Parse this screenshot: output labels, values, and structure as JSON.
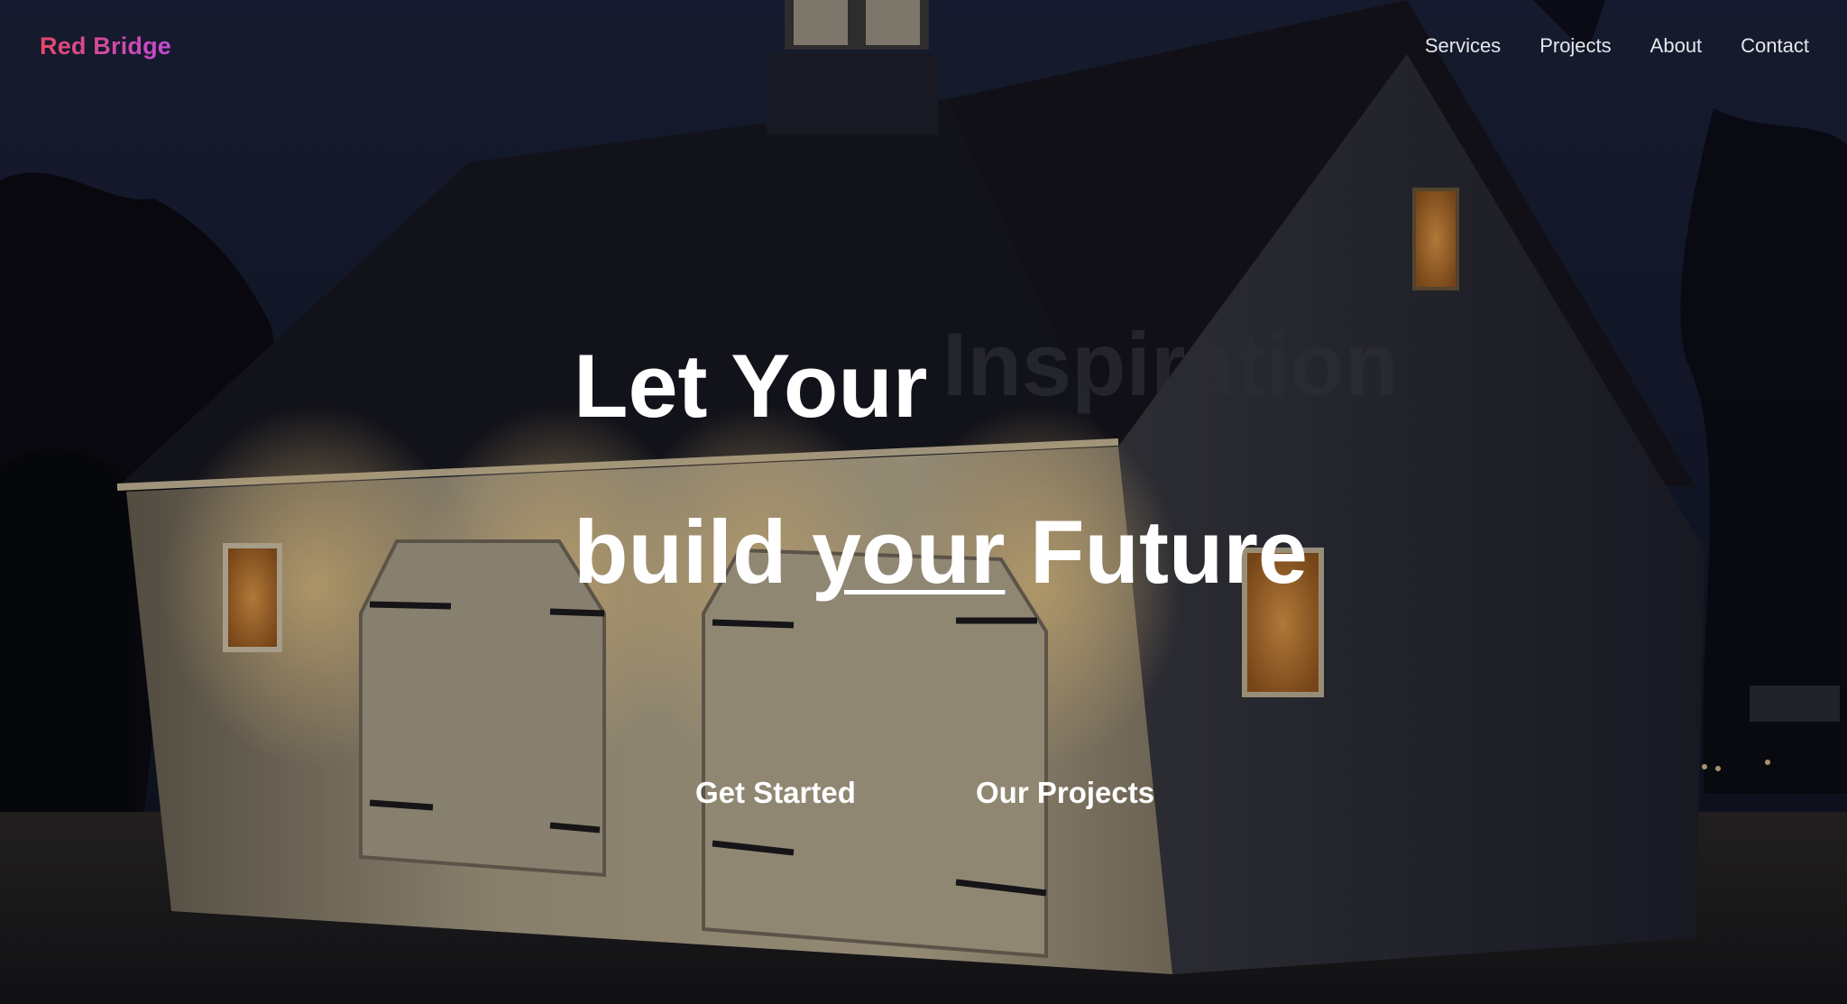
{
  "brand": {
    "name": "Red Bridge"
  },
  "nav": {
    "items": [
      {
        "label": "Services"
      },
      {
        "label": "Projects"
      },
      {
        "label": "About"
      },
      {
        "label": "Contact"
      }
    ]
  },
  "hero": {
    "line1": "Let Your",
    "rotating_word": "Inspiration",
    "line2_start": "build",
    "line2_emphasis": "your",
    "line2_end": "Future",
    "primary_cta": "Get Started",
    "secondary_cta": "Our Projects"
  },
  "colors": {
    "brand_gradient_start": "#e5486a",
    "brand_gradient_end": "#c24bd4",
    "headline": "#ffffff",
    "ghost_word": "#2b2c34"
  }
}
